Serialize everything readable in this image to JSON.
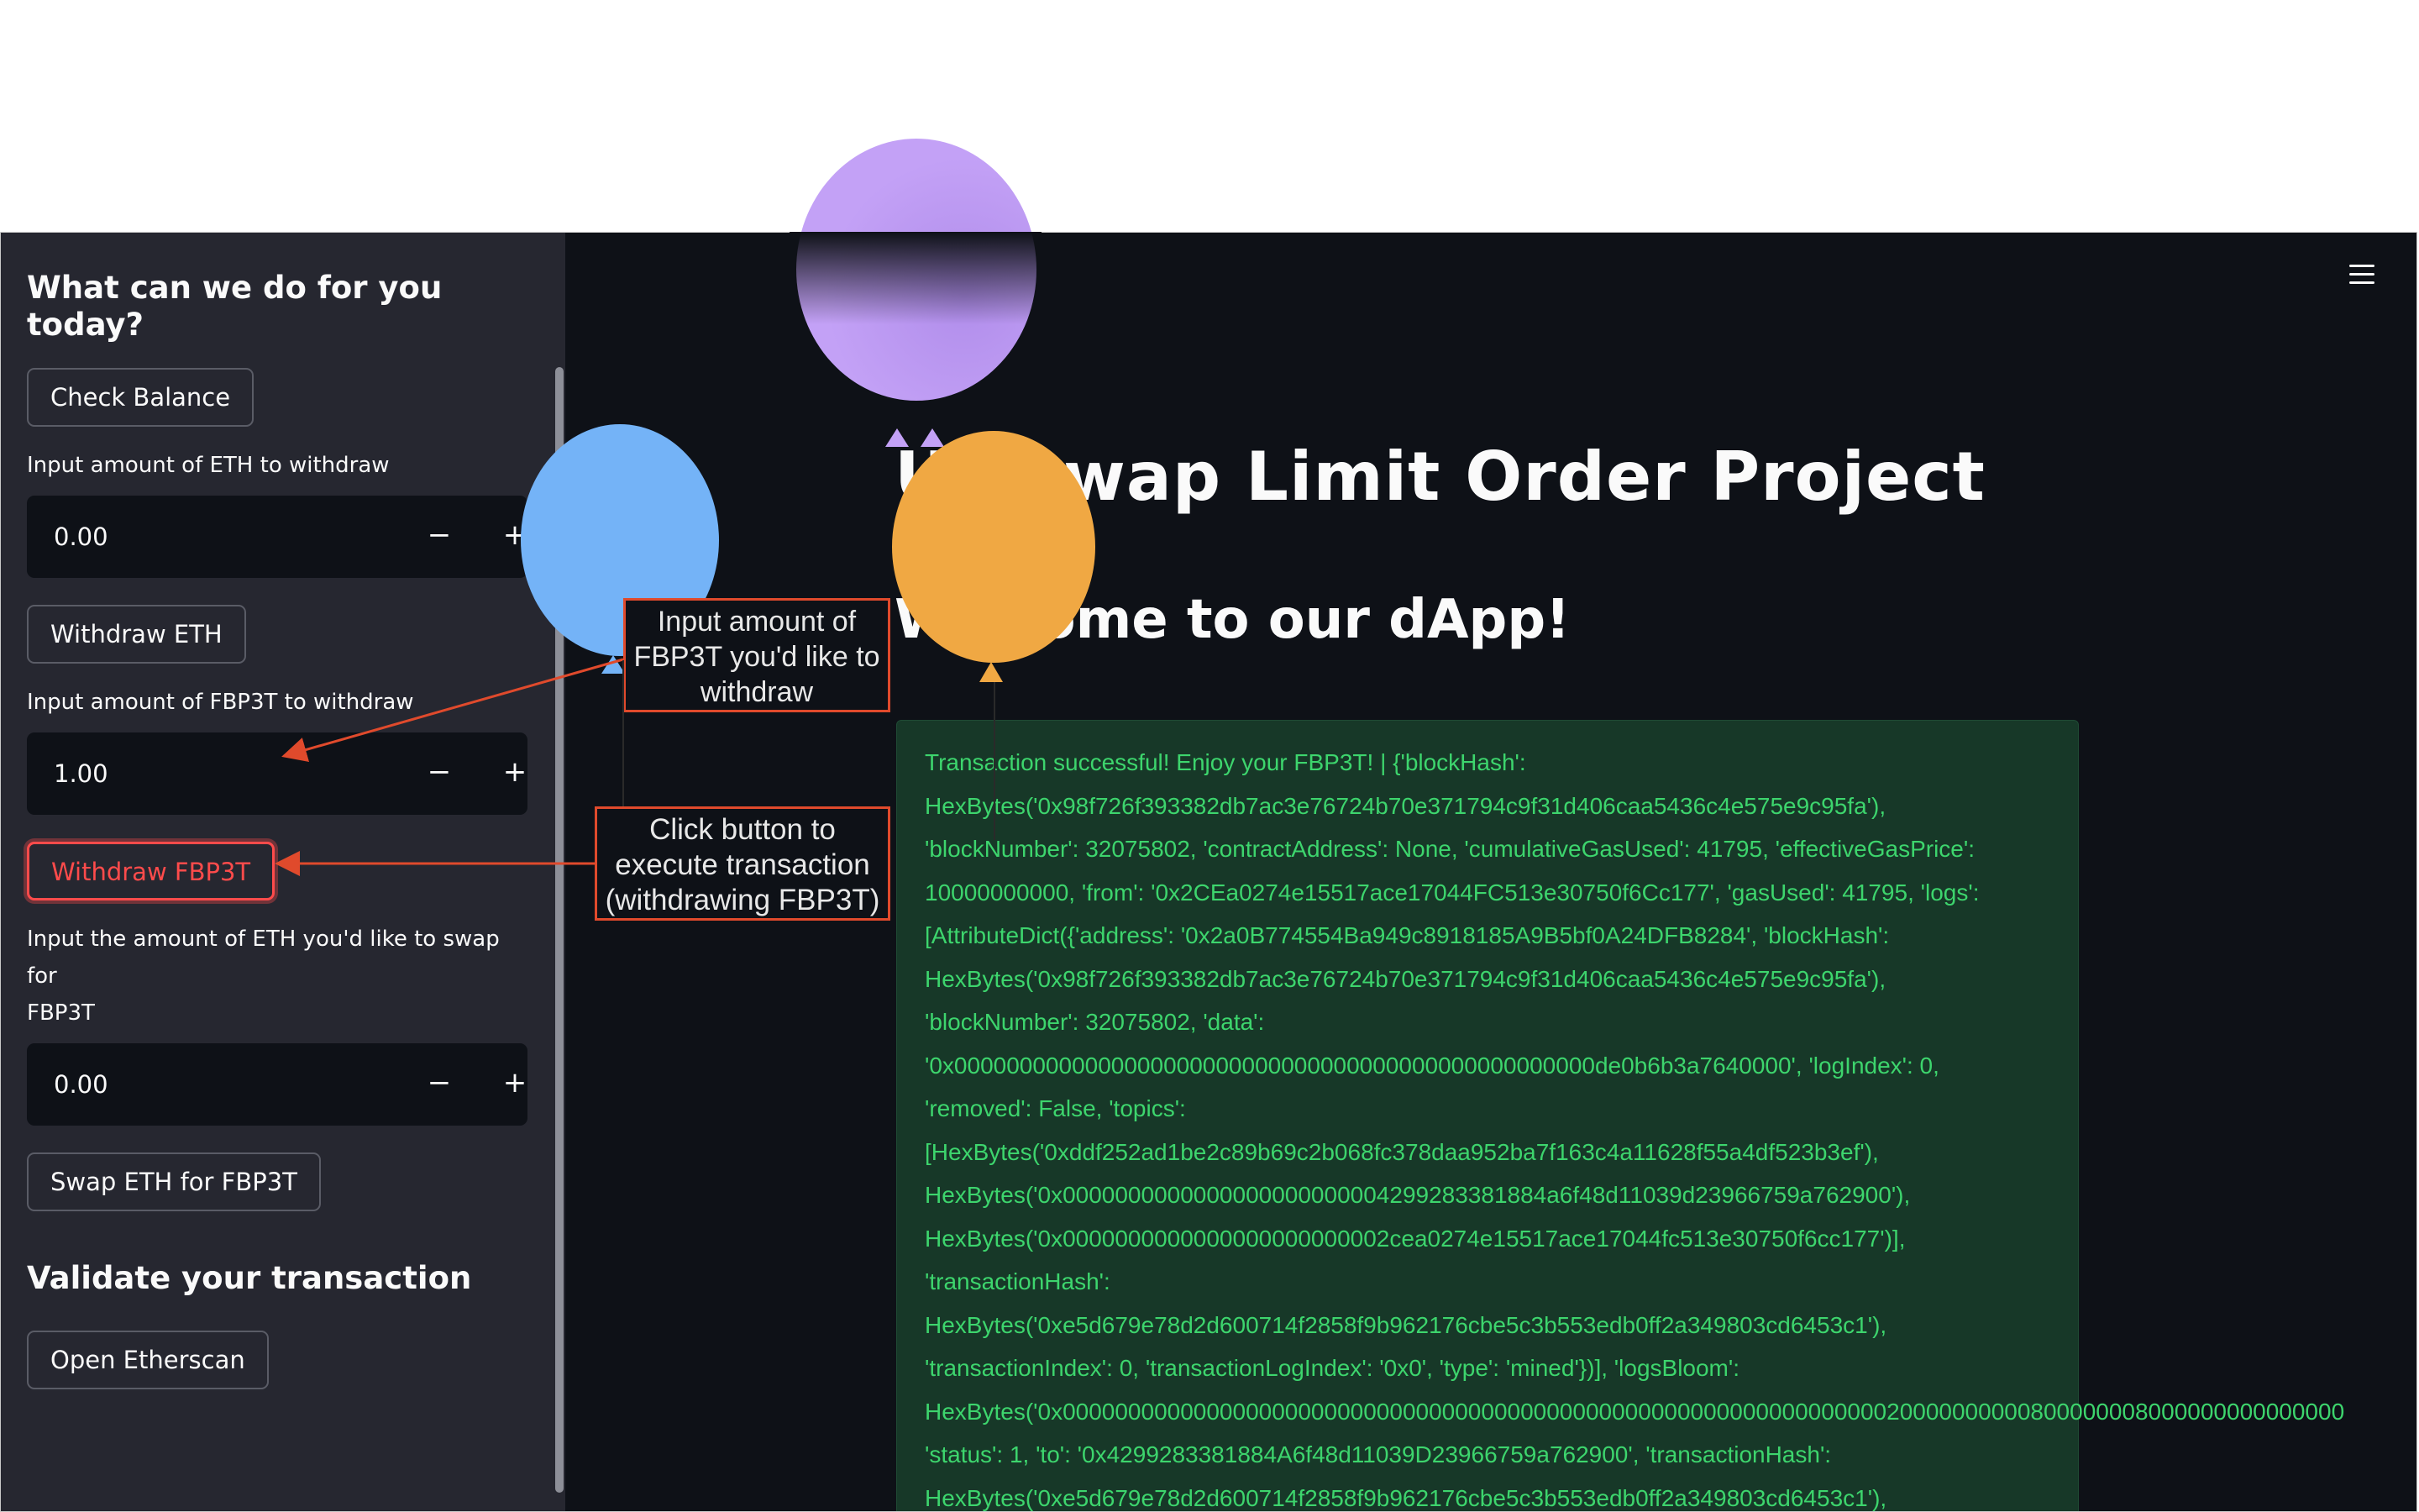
{
  "sidebar": {
    "title": "What can we do for you today?",
    "check_balance_label": "Check Balance",
    "eth_withdraw_label": "Input amount of ETH to withdraw",
    "eth_withdraw_value": "0.00",
    "withdraw_eth_label": "Withdraw ETH",
    "fbp3t_withdraw_label": "Input amount of FBP3T to withdraw",
    "fbp3t_withdraw_value": "1.00",
    "withdraw_fbp3t_label": "Withdraw FBP3T",
    "swap_label_line1": "Input the amount of ETH you'd like to swap for",
    "swap_label_line2": "FBP3T",
    "swap_value": "0.00",
    "swap_button_label": "Swap ETH for FBP3T",
    "validate_title": "Validate your transaction",
    "etherscan_label": "Open Etherscan",
    "minus_symbol": "−",
    "plus_symbol": "+"
  },
  "main": {
    "title": "Uniswap Limit Order Project",
    "subtitle": "Welcome to our dApp!",
    "success_message": "Transaction successful! Enjoy your FBP3T! | {'blockHash':\nHexBytes('0x98f726f393382db7ac3e76724b70e371794c9f31d406caa5436c4e575e9c95fa'),\n'blockNumber': 32075802, 'contractAddress': None, 'cumulativeGasUsed': 41795, 'effectiveGasPrice':\n10000000000, 'from': '0x2CEa0274e15517ace17044FC513e30750f6Cc177', 'gasUsed': 41795, 'logs':\n[AttributeDict({'address': '0x2a0B774554Ba949c8918185A9B5bf0A24DFB8284', 'blockHash':\nHexBytes('0x98f726f393382db7ac3e76724b70e371794c9f31d406caa5436c4e575e9c95fa'),\n'blockNumber': 32075802, 'data':\n'0x0000000000000000000000000000000000000000000000000de0b6b3a7640000', 'logIndex': 0,\n'removed': False, 'topics':\n[HexBytes('0xddf252ad1be2c89b69c2b068fc378daa952ba7f163c4a11628f55a4df523b3ef'),\nHexBytes('0x0000000000000000000000004299283381884a6f48d11039d23966759a762900'),\nHexBytes('0x0000000000000000000000002cea0274e15517ace17044fc513e30750f6cc177')],\n'transactionHash':\nHexBytes('0xe5d679e78d2d600714f2858f9b962176cbe5c3b553edb0ff2a349803cd6453c1'),\n'transactionIndex': 0, 'transactionLogIndex': '0x0', 'type': 'mined'})], 'logsBloom':\nHexBytes('0x00000000000000000000000000000000000000000000000000000000000000020000000000800000008000000000000000\n'status': 1, 'to': '0x4299283381884A6f48d11039D23966759a762900', 'transactionHash':\nHexBytes('0xe5d679e78d2d600714f2858f9b962176cbe5c3b553edb0ff2a349803cd6453c1'),"
  },
  "annotations": {
    "input_note": "Input amount of FBP3T you'd like to withdraw",
    "click_note": "Click button to execute transaction (withdrawing FBP3T)"
  },
  "colors": {
    "sidebar_bg": "#262730",
    "main_bg": "#0e1117",
    "accent_red": "#ff4b4b",
    "success_text": "#3dd56d",
    "annotation_border": "#e04a2c",
    "balloon_purple": "#c3a1f6",
    "balloon_blue": "#74b3f7",
    "balloon_orange": "#f0a843"
  },
  "icons": {
    "menu": "hamburger-menu-icon"
  }
}
